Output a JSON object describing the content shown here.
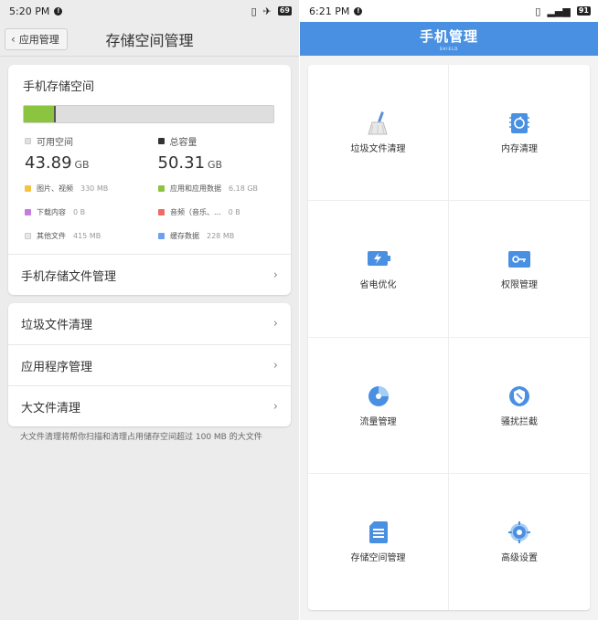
{
  "left": {
    "status": {
      "time": "5:20 PM",
      "battery": "69"
    },
    "title": "存储空间管理",
    "back_label": "应用管理",
    "storage": {
      "heading": "手机存储空间",
      "used_fraction": 0.13,
      "available_label": "可用空间",
      "available_value": "43.89",
      "available_unit": "GB",
      "total_label": "总容量",
      "total_value": "50.31",
      "total_unit": "GB",
      "legend": [
        {
          "name": "图片、视频",
          "size": "330 MB",
          "color": "#f5c242"
        },
        {
          "name": "应用和应用数据",
          "size": "6.18 GB",
          "color": "#8bc53f"
        },
        {
          "name": "下载内容",
          "size": "0 B",
          "color": "#c77be0"
        },
        {
          "name": "音频（音乐、...",
          "size": "0 B",
          "color": "#ef6a5f"
        },
        {
          "name": "其他文件",
          "size": "415 MB",
          "color": "#e8e8e8"
        },
        {
          "name": "缓存数据",
          "size": "228 MB",
          "color": "#6f9ff0"
        }
      ],
      "file_mgmt_label": "手机存储文件管理"
    },
    "list": [
      "垃圾文件清理",
      "应用程序管理",
      "大文件清理"
    ],
    "footnote": "大文件清理将帮你扫描和清理占用储存空间超过 100 MB 的大文件"
  },
  "right": {
    "status": {
      "time": "6:21 PM",
      "battery": "91"
    },
    "title": "手机管理",
    "subtitle": "SHIELD",
    "accent": "#4a90e2",
    "tiles": [
      {
        "label": "垃圾文件清理",
        "icon": "broom-icon"
      },
      {
        "label": "内存清理",
        "icon": "memory-chip-icon"
      },
      {
        "label": "省电优化",
        "icon": "battery-bolt-icon"
      },
      {
        "label": "权限管理",
        "icon": "key-card-icon"
      },
      {
        "label": "流量管理",
        "icon": "data-usage-icon"
      },
      {
        "label": "骚扰拦截",
        "icon": "shield-block-icon"
      },
      {
        "label": "存储空间管理",
        "icon": "sd-card-icon"
      },
      {
        "label": "高级设置",
        "icon": "gear-icon"
      }
    ]
  }
}
